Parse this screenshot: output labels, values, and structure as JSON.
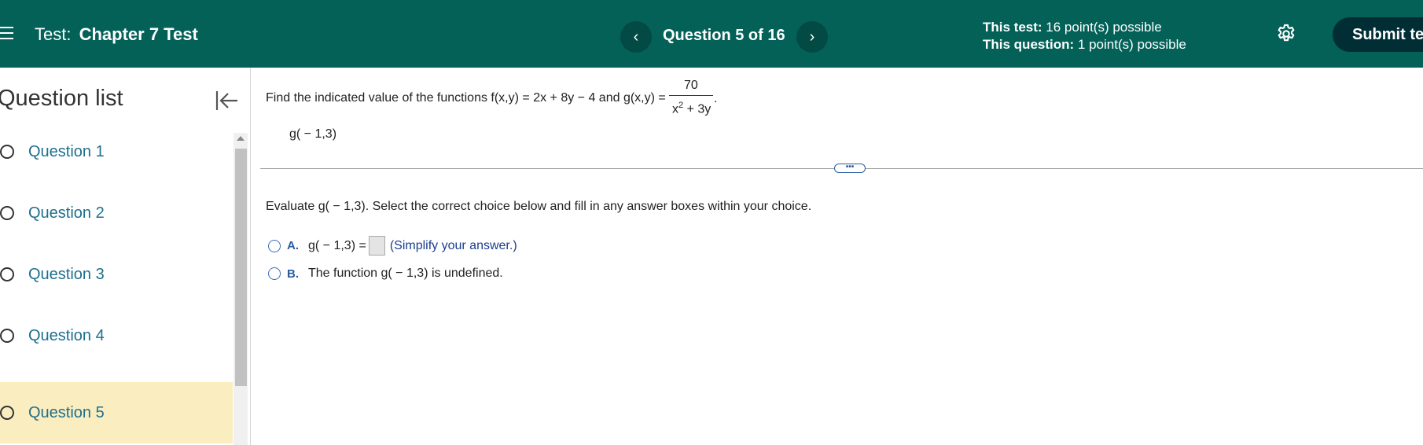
{
  "header": {
    "title_prefix": "Test:",
    "title_name": "Chapter 7 Test",
    "question_counter": "Question 5 of 16",
    "prev_icon": "‹",
    "next_icon": "›",
    "points_test_label": "This test:",
    "points_test_value": "16 point(s) possible",
    "points_question_label": "This question:",
    "points_question_value": "1 point(s) possible",
    "submit_label": "Submit test"
  },
  "sidebar": {
    "title": "Question list",
    "items": [
      {
        "label": "Question 1"
      },
      {
        "label": "Question 2"
      },
      {
        "label": "Question 3"
      },
      {
        "label": "Question 4"
      },
      {
        "label": "Question 5"
      }
    ],
    "selected_index": 4
  },
  "question": {
    "prompt": "Find the indicated value of the functions f(x,y) = 2x + 8y − 4 and g(x,y) =",
    "fraction_numerator": "70",
    "fraction_denominator_base": "x",
    "fraction_denominator_exp": "2",
    "fraction_denominator_rest": " + 3y",
    "trailing_period": ".",
    "expression": "g( − 1,3)",
    "divider_handle": "•••",
    "instruction": "Evaluate g( − 1,3). Select the correct choice below and fill in any answer boxes within your choice.",
    "choices": [
      {
        "letter": "A.",
        "text": "g( − 1,3) =",
        "hint": "(Simplify your answer.)"
      },
      {
        "letter": "B.",
        "text": "The function g( − 1,3) is undefined."
      }
    ]
  },
  "colors": {
    "header_bg": "#036158",
    "submit_bg": "#012e35",
    "selected_bg": "#faedbf",
    "link": "#1e6f8e"
  }
}
